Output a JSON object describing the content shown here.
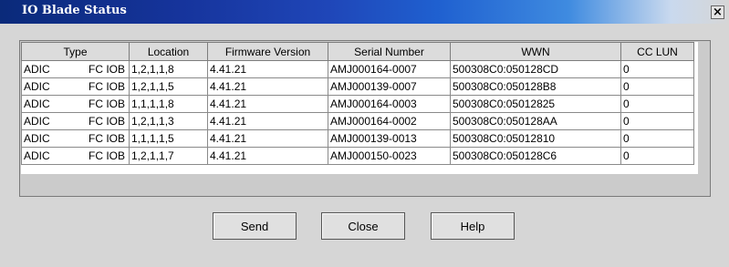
{
  "window": {
    "title": "IO Blade Status",
    "close_label": "×"
  },
  "table": {
    "columns": [
      "Type",
      "Location",
      "Firmware Version",
      "Serial Number",
      "WWN",
      "CC LUN"
    ],
    "rows": [
      {
        "type_vendor": "ADIC",
        "type_kind": "FC IOB",
        "location": "1,2,1,1,8",
        "firmware": "4.41.21",
        "serial": "AMJ000164-0007",
        "wwn": "500308C0:050128CD",
        "cc_lun": "0"
      },
      {
        "type_vendor": "ADIC",
        "type_kind": "FC IOB",
        "location": "1,2,1,1,5",
        "firmware": "4.41.21",
        "serial": "AMJ000139-0007",
        "wwn": "500308C0:050128B8",
        "cc_lun": "0"
      },
      {
        "type_vendor": "ADIC",
        "type_kind": "FC IOB",
        "location": "1,1,1,1,8",
        "firmware": "4.41.21",
        "serial": "AMJ000164-0003",
        "wwn": "500308C0:05012825",
        "cc_lun": "0"
      },
      {
        "type_vendor": "ADIC",
        "type_kind": "FC IOB",
        "location": "1,2,1,1,3",
        "firmware": "4.41.21",
        "serial": "AMJ000164-0002",
        "wwn": "500308C0:050128AA",
        "cc_lun": "0"
      },
      {
        "type_vendor": "ADIC",
        "type_kind": "FC IOB",
        "location": "1,1,1,1,5",
        "firmware": "4.41.21",
        "serial": "AMJ000139-0013",
        "wwn": "500308C0:05012810",
        "cc_lun": "0"
      },
      {
        "type_vendor": "ADIC",
        "type_kind": "FC IOB",
        "location": "1,2,1,1,7",
        "firmware": "4.41.21",
        "serial": "AMJ000150-0023",
        "wwn": "500308C0:050128C6",
        "cc_lun": "0"
      }
    ]
  },
  "buttons": {
    "send": "Send",
    "close": "Close",
    "help": "Help"
  },
  "colors": {
    "title_bar_start": "#0a2a7a",
    "dialog_bg": "#d6d6d6"
  }
}
